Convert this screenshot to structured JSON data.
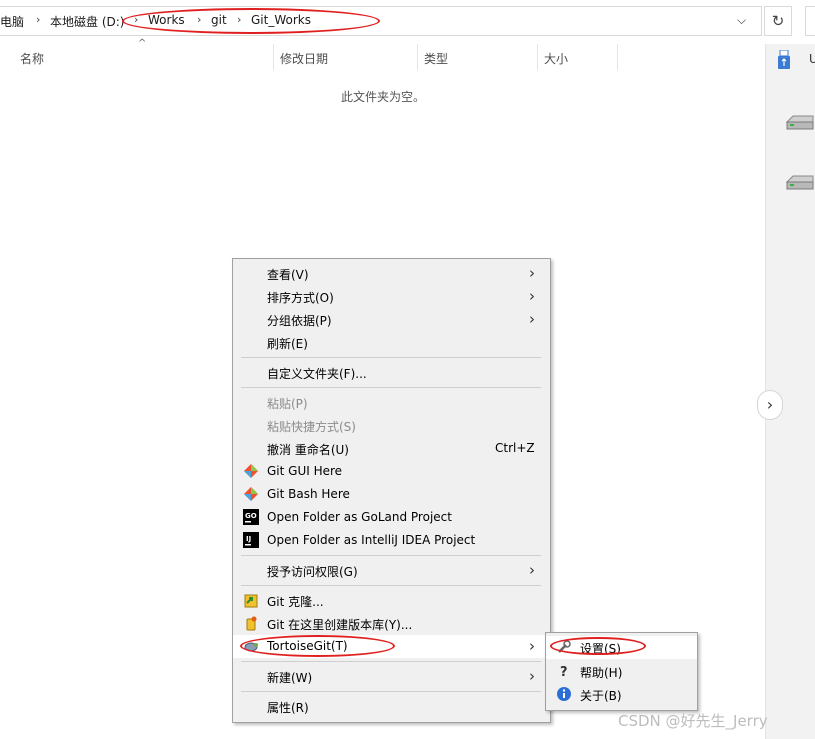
{
  "address": {
    "crumbs": [
      "电脑",
      "本地磁盘 (D:)",
      "Works",
      "git",
      "Git_Works"
    ],
    "dropdown_icon": "chevron-down-icon",
    "refresh_icon": "refresh-icon"
  },
  "columns": {
    "name": "名称",
    "modified": "修改日期",
    "type": "类型",
    "size": "大小"
  },
  "empty_message": "此文件夹为空。",
  "right_panel": {
    "usb_label": "U"
  },
  "menu": {
    "view": "查看(V)",
    "sort": "排序方式(O)",
    "group": "分组依据(P)",
    "refresh": "刷新(E)",
    "customize": "自定义文件夹(F)...",
    "paste": "粘贴(P)",
    "paste_shortcut": "粘贴快捷方式(S)",
    "undo_rename": "撤消 重命名(U)",
    "undo_shortcut": "Ctrl+Z",
    "git_gui": "Git GUI Here",
    "git_bash": "Git Bash Here",
    "goland": "Open Folder as GoLand Project",
    "intellij": "Open Folder as IntelliJ IDEA Project",
    "grant_access": "授予访问权限(G)",
    "git_clone": "Git 克隆...",
    "git_create_repo": "Git 在这里创建版本库(Y)...",
    "tortoisegit": "TortoiseGit(T)",
    "new": "新建(W)",
    "properties": "属性(R)"
  },
  "submenu": {
    "settings": "设置(S)",
    "help": "帮助(H)",
    "about": "关于(B)"
  },
  "watermark": "CSDN @好先生_Jerry"
}
